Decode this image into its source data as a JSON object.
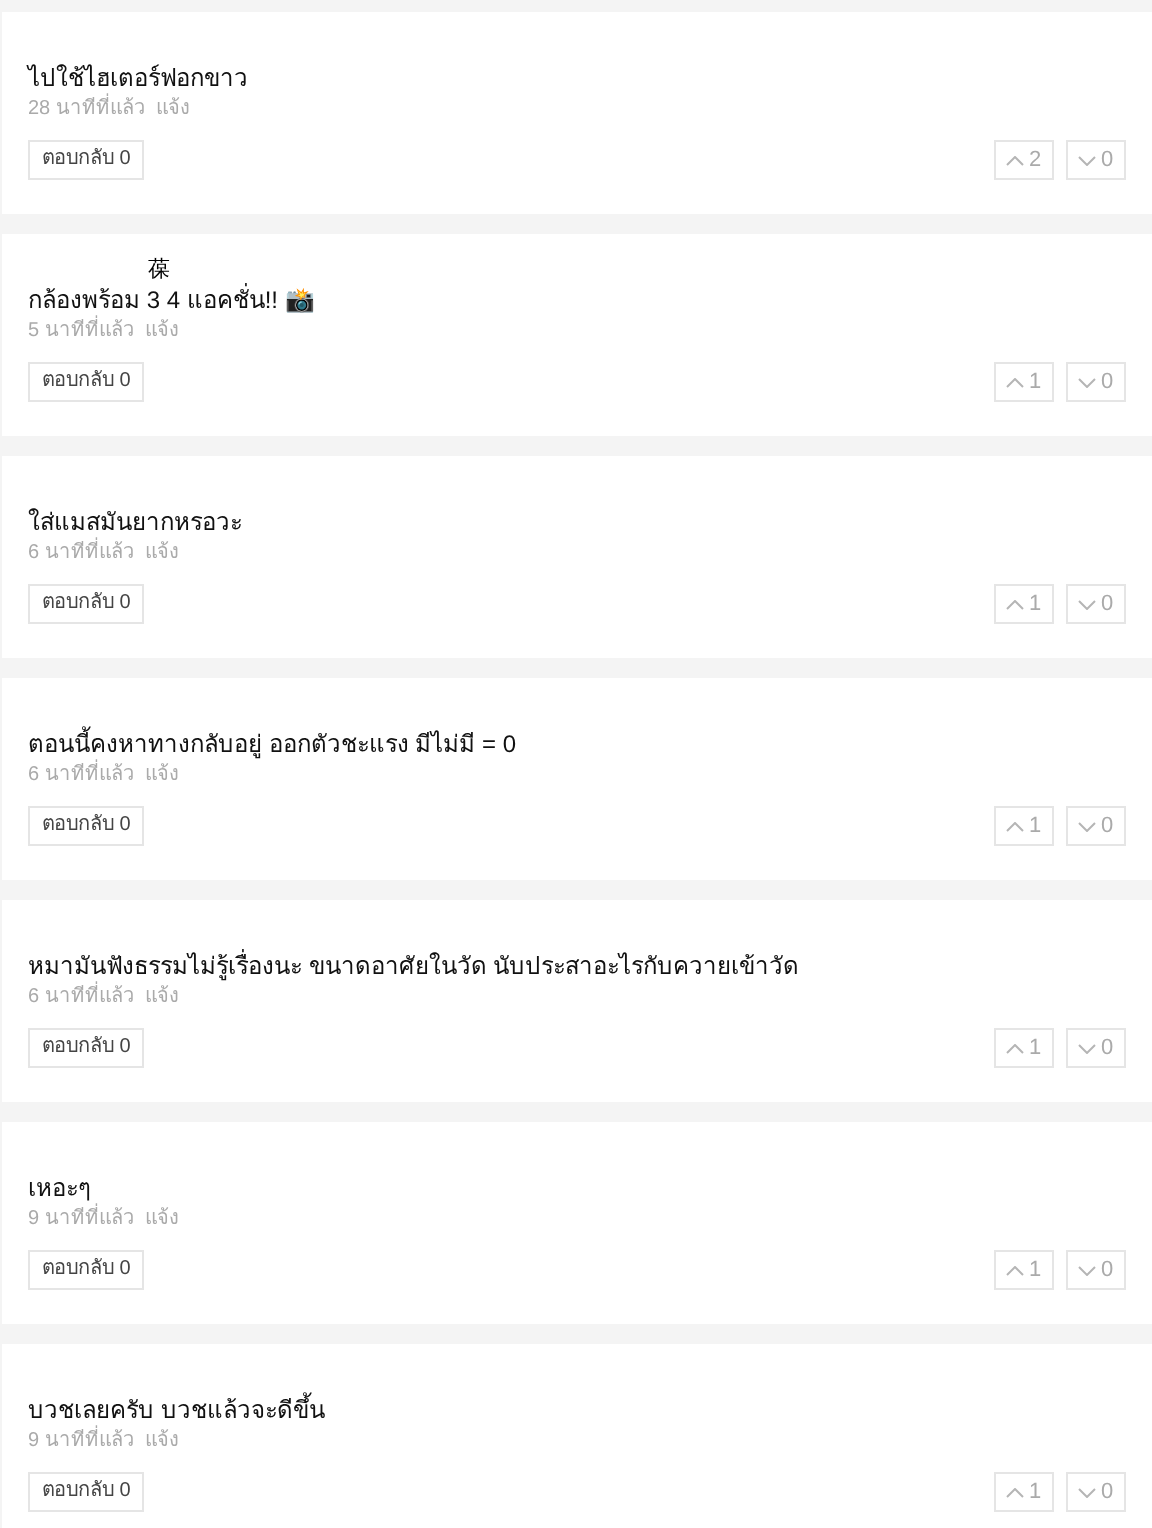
{
  "comments": [
    {
      "text": "ไปใช้ไฮเตอร์ฟอกขาว",
      "time": "28 นาทีที่แล้ว",
      "report": "แจ้ง",
      "reply": "ตอบกลับ 0",
      "up": "2",
      "down": "0"
    },
    {
      "header": "葆",
      "text": "กล้องพร้อม 3 4 แอคชั่น!! 📸",
      "time": "5 นาทีที่แล้ว",
      "report": "แจ้ง",
      "reply": "ตอบกลับ 0",
      "up": "1",
      "down": "0"
    },
    {
      "text": "ใส่แมสมันยากหรอวะ",
      "time": "6 นาทีที่แล้ว",
      "report": "แจ้ง",
      "reply": "ตอบกลับ 0",
      "up": "1",
      "down": "0"
    },
    {
      "text": "ตอนนี้คงหาทางกลับอยู่ ออกตัวชะแรง มีไม่มี = 0",
      "time": "6 นาทีที่แล้ว",
      "report": "แจ้ง",
      "reply": "ตอบกลับ 0",
      "up": "1",
      "down": "0"
    },
    {
      "text": "หมามันฟังธรรมไม่รู้เรื่องนะ ขนาดอาศัยในวัด นับประสาอะไรกับควายเข้าวัด",
      "time": "6 นาทีที่แล้ว",
      "report": "แจ้ง",
      "reply": "ตอบกลับ 0",
      "up": "1",
      "down": "0"
    },
    {
      "text": "เหอะๆ",
      "time": "9 นาทีที่แล้ว",
      "report": "แจ้ง",
      "reply": "ตอบกลับ 0",
      "up": "1",
      "down": "0"
    },
    {
      "text": "บวชเลยครับ บวชแล้วจะดีขึ้น",
      "time": "9 นาทีที่แล้ว",
      "report": "แจ้ง",
      "reply": "ตอบกลับ 0",
      "up": "1",
      "down": "0"
    }
  ]
}
